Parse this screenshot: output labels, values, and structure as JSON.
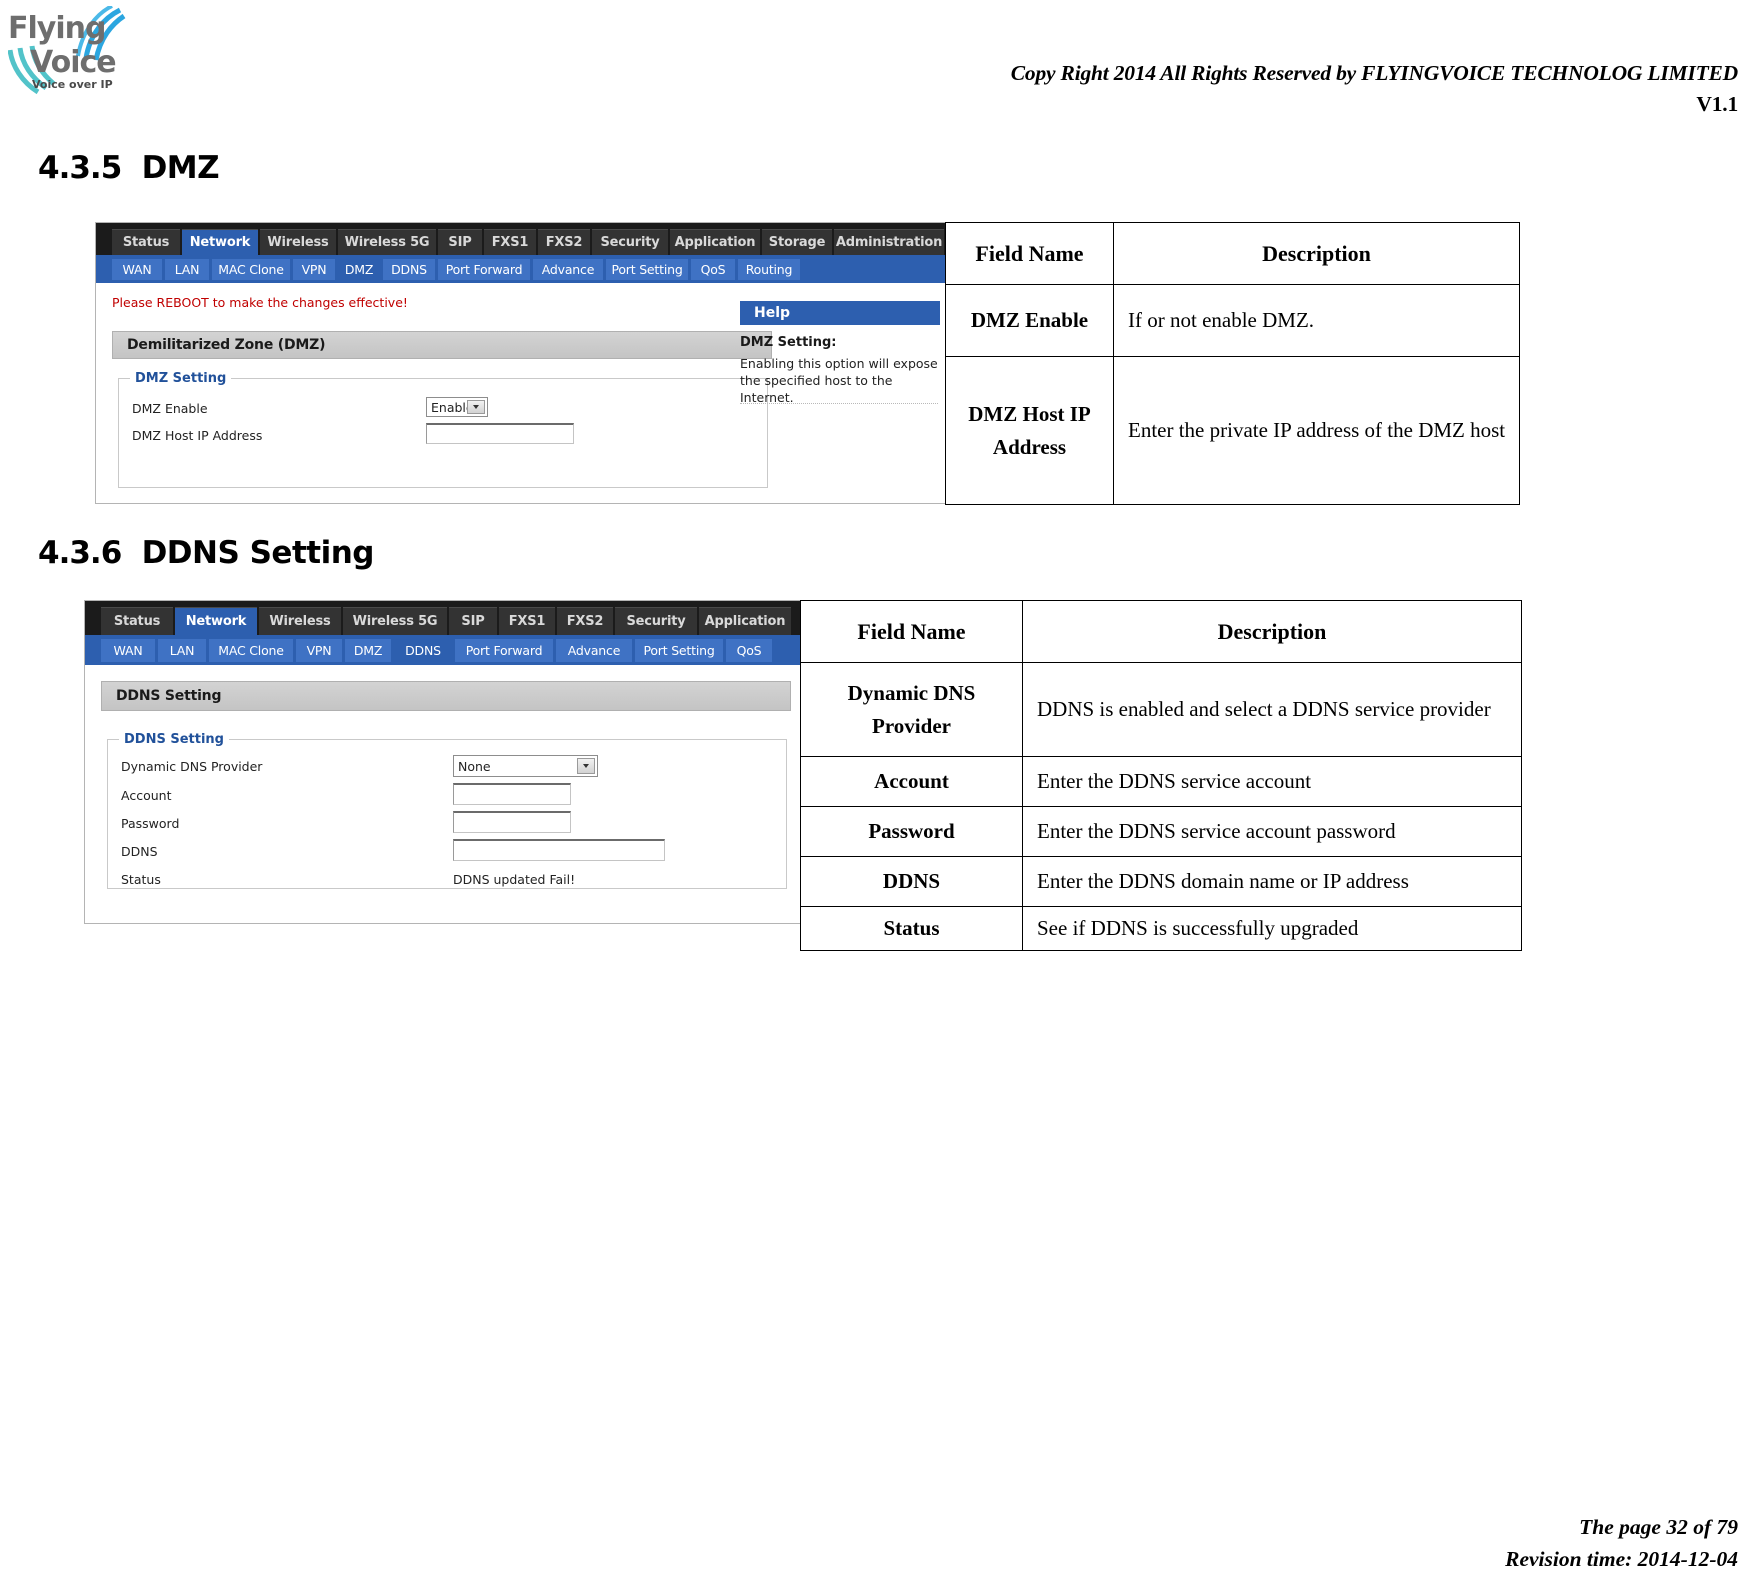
{
  "header": {
    "copyright": "Copy Right 2014 All Rights Reserved by FLYINGVOICE TECHNOLOG LIMITED",
    "version": "V1.1",
    "logo_line1": "Flying",
    "logo_line2": "Voice",
    "logo_tagline": "Voice over IP"
  },
  "sections": [
    {
      "number": "4.3.5",
      "title": "DMZ"
    },
    {
      "number": "4.3.6",
      "title": "DDNS Setting"
    }
  ],
  "dmz_screenshot": {
    "nav_tabs": [
      {
        "label": "Status",
        "active": false
      },
      {
        "label": "Network",
        "active": true
      },
      {
        "label": "Wireless",
        "active": false
      },
      {
        "label": "Wireless 5G",
        "active": false
      },
      {
        "label": "SIP",
        "active": false
      },
      {
        "label": "FXS1",
        "active": false
      },
      {
        "label": "FXS2",
        "active": false
      },
      {
        "label": "Security",
        "active": false
      },
      {
        "label": "Application",
        "active": false
      },
      {
        "label": "Storage",
        "active": false
      },
      {
        "label": "Administration",
        "active": false
      }
    ],
    "sub_tabs": [
      {
        "label": "WAN",
        "active": false
      },
      {
        "label": "LAN",
        "active": false
      },
      {
        "label": "MAC Clone",
        "active": false
      },
      {
        "label": "VPN",
        "active": false
      },
      {
        "label": "DMZ",
        "active": true
      },
      {
        "label": "DDNS",
        "active": false
      },
      {
        "label": "Port Forward",
        "active": false
      },
      {
        "label": "Advance",
        "active": false
      },
      {
        "label": "Port Setting",
        "active": false
      },
      {
        "label": "QoS",
        "active": false
      },
      {
        "label": "Routing",
        "active": false
      }
    ],
    "reboot_message": "Please REBOOT to make the changes effective!",
    "panel_title": "Demilitarized Zone (DMZ)",
    "fieldset_legend": "DMZ Setting",
    "dmz_enable_label": "DMZ Enable",
    "dmz_enable_value": "Enable",
    "dmz_host_label": "DMZ Host IP Address",
    "dmz_host_value": "",
    "help_head": "Help",
    "help_title": "DMZ Setting:",
    "help_body": "Enabling this option will expose the specified host to the Internet."
  },
  "dmz_table": {
    "headers": [
      "Field Name",
      "Description"
    ],
    "rows": [
      {
        "field": "DMZ Enable",
        "desc": "If or not enable DMZ."
      },
      {
        "field": "DMZ Host IP Address",
        "desc": "Enter the private IP address of the DMZ host"
      }
    ]
  },
  "ddns_screenshot": {
    "nav_tabs": [
      {
        "label": "Status",
        "active": false
      },
      {
        "label": "Network",
        "active": true
      },
      {
        "label": "Wireless",
        "active": false
      },
      {
        "label": "Wireless 5G",
        "active": false
      },
      {
        "label": "SIP",
        "active": false
      },
      {
        "label": "FXS1",
        "active": false
      },
      {
        "label": "FXS2",
        "active": false
      },
      {
        "label": "Security",
        "active": false
      },
      {
        "label": "Application",
        "active": false
      }
    ],
    "sub_tabs": [
      {
        "label": "WAN",
        "active": false
      },
      {
        "label": "LAN",
        "active": false
      },
      {
        "label": "MAC Clone",
        "active": false
      },
      {
        "label": "VPN",
        "active": false
      },
      {
        "label": "DMZ",
        "active": false
      },
      {
        "label": "DDNS",
        "active": true
      },
      {
        "label": "Port Forward",
        "active": false
      },
      {
        "label": "Advance",
        "active": false
      },
      {
        "label": "Port Setting",
        "active": false
      },
      {
        "label": "QoS",
        "active": false
      }
    ],
    "panel_title": "DDNS Setting",
    "fieldset_legend": "DDNS Setting",
    "provider_label": "Dynamic DNS Provider",
    "provider_value": "None",
    "account_label": "Account",
    "account_value": "",
    "password_label": "Password",
    "password_value": "",
    "ddns_label": "DDNS",
    "ddns_value": "",
    "status_label": "Status",
    "status_value": "DDNS updated Fail!"
  },
  "ddns_table": {
    "headers": [
      "Field Name",
      "Description"
    ],
    "rows": [
      {
        "field": "Dynamic DNS Provider",
        "desc": "DDNS is enabled and select a DDNS service provider"
      },
      {
        "field": "Account",
        "desc": "Enter the DDNS service account"
      },
      {
        "field": "Password",
        "desc": "Enter the DDNS service account password"
      },
      {
        "field": "DDNS",
        "desc": "Enter the DDNS domain name or IP address"
      },
      {
        "field": "Status",
        "desc": "See if DDNS is successfully upgraded"
      }
    ]
  },
  "footer": {
    "page": "The page 32 of 79",
    "revision": "Revision time: 2014-12-04"
  },
  "colors": {
    "accent_blue": "#2d5faf",
    "subtab_blue": "#3f72c4",
    "nav_dark": "#333333",
    "error_red": "#c00000",
    "panel_gray": "#d3d3d3"
  }
}
